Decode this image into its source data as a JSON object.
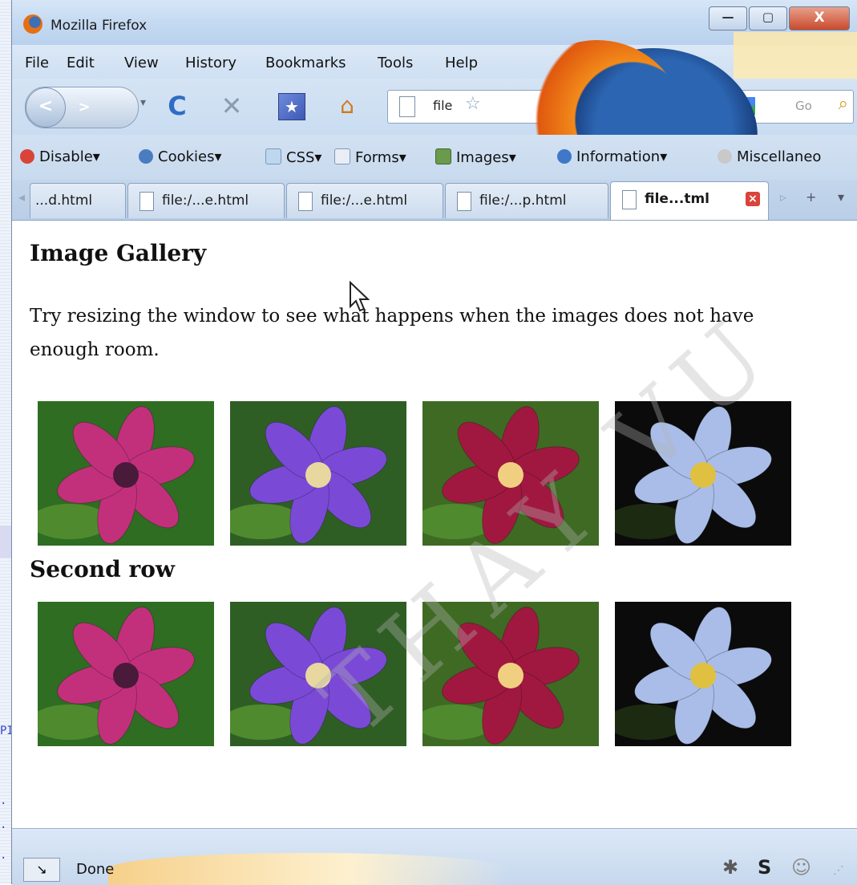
{
  "window": {
    "title": "Mozilla Firefox",
    "controls": {
      "minimize": "—",
      "maximize": "▢",
      "close": "X"
    }
  },
  "menu": [
    "File",
    "Edit",
    "View",
    "History",
    "Bookmarks",
    "Tools",
    "Help"
  ],
  "navbar": {
    "url_text": "file",
    "search_placeholder": "Go"
  },
  "webdev_toolbar": [
    {
      "label": "Disable",
      "icon": "disable-icon",
      "color": "#d9443a"
    },
    {
      "label": "Cookies",
      "icon": "cookies-icon",
      "color": "#4a7cc0"
    },
    {
      "label": "CSS",
      "icon": "css-icon",
      "color": "#bcd7ee"
    },
    {
      "label": "Forms",
      "icon": "forms-icon",
      "color": "#9fb7d4"
    },
    {
      "label": "Images",
      "icon": "images-icon",
      "color": "#6a9a4c"
    },
    {
      "label": "Information",
      "icon": "information-icon",
      "color": "#3f78c9"
    },
    {
      "label": "Miscellaneo",
      "icon": "miscellaneous-icon",
      "color": "#c0c0c0"
    }
  ],
  "tabs": [
    {
      "label": "...d.html",
      "active": false
    },
    {
      "label": "file:/...e.html",
      "active": false
    },
    {
      "label": "file:/...e.html",
      "active": false
    },
    {
      "label": "file:/...p.html",
      "active": false
    },
    {
      "label": "file...tml",
      "active": true
    }
  ],
  "page": {
    "heading": "Image Gallery",
    "paragraph": "Try resizing the window to see what happens when the images does not have enough room.",
    "second_heading": "Second row",
    "flowers": [
      {
        "name": "pink-clematis",
        "petal": "#c2307c",
        "center": "#4a1a3a",
        "bg": "#2e6d22"
      },
      {
        "name": "purple-clematis",
        "petal": "#7a4ad6",
        "center": "#e8d8a0",
        "bg": "#2f5e25"
      },
      {
        "name": "red-clematis",
        "petal": "#a01840",
        "center": "#f0d080",
        "bg": "#3f6a24"
      },
      {
        "name": "blue-clematis",
        "petal": "#a9bde8",
        "center": "#e0c040",
        "bg": "#0b0b0b"
      }
    ]
  },
  "status": {
    "text": "Done"
  },
  "background_fragments": [
    "PI",
    ". . ",
    "  . l",
    "  . l"
  ],
  "watermark": "THAY VU"
}
